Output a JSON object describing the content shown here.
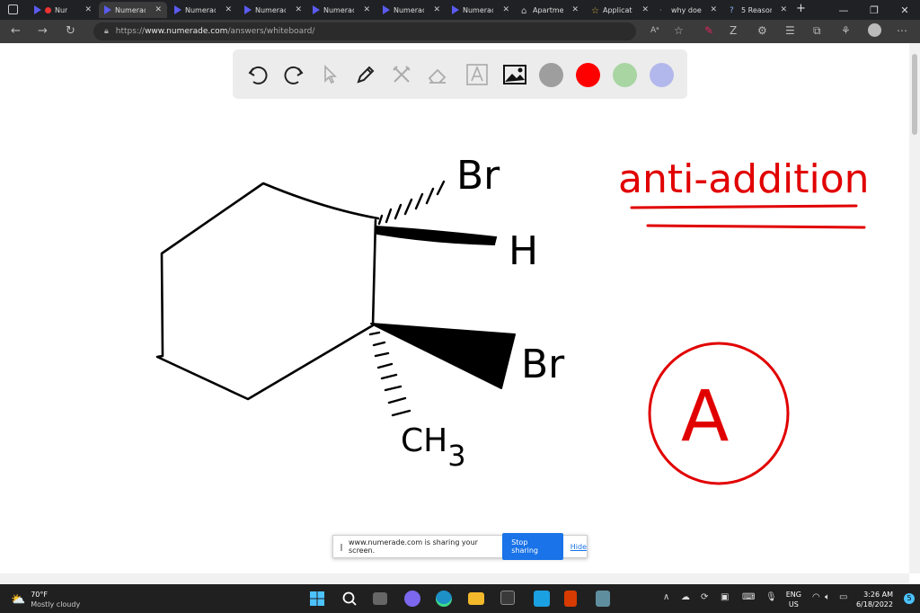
{
  "browser": {
    "tabs": [
      {
        "title": "Nur",
        "active": false
      },
      {
        "title": "Numerade",
        "active": true
      },
      {
        "title": "Numerade",
        "active": false
      },
      {
        "title": "Numerade",
        "active": false
      },
      {
        "title": "Numerade",
        "active": false
      },
      {
        "title": "Numerade",
        "active": false
      },
      {
        "title": "Numerade",
        "active": false
      },
      {
        "title": "Apartment",
        "active": false
      },
      {
        "title": "Applicat",
        "active": false
      },
      {
        "title": "why doe",
        "active": false
      },
      {
        "title": "5 Reason",
        "active": false
      }
    ],
    "new_tab": "+",
    "url": "https://www.numerade.com/answers/whiteboard/",
    "url_prefix": "https://",
    "url_domain": "www.numerade.com",
    "url_path": "/answers/whiteboard/",
    "read_aloud": "Aᵃ"
  },
  "whiteboard": {
    "tools": [
      "undo-icon",
      "redo-icon",
      "pointer-icon",
      "pen-icon",
      "tools-icon",
      "eraser-icon",
      "text-icon",
      "image-icon"
    ],
    "colors": [
      "#9e9e9e",
      "#ff0000",
      "#a8d5a2",
      "#b3b8ec"
    ],
    "handwriting": {
      "br_top": "Br",
      "h": "H",
      "br_bottom": "Br",
      "ch3": "CH",
      "ch3_sub": "3",
      "anti_addition": "anti-addition",
      "answer": "A"
    },
    "ink_black": "#000000",
    "ink_red": "#e10000"
  },
  "share_bar": {
    "message": "www.numerade.com is sharing your screen.",
    "stop_label": "Stop sharing",
    "hide_label": "Hide"
  },
  "taskbar": {
    "temperature": "70°F",
    "condition": "Mostly cloudy",
    "lang_top": "ENG",
    "lang_bottom": "US",
    "time": "3:26 AM",
    "date": "6/18/2022",
    "notification_count": "5"
  }
}
